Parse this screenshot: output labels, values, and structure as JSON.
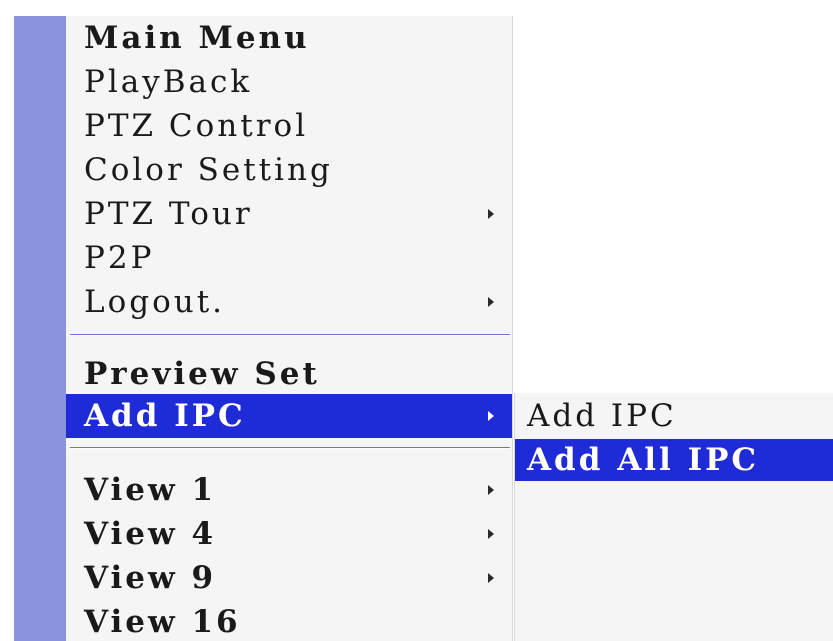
{
  "main_menu": {
    "items": [
      {
        "label": "Main Menu",
        "has_submenu": false
      },
      {
        "label": "PlayBack",
        "has_submenu": false
      },
      {
        "label": "PTZ Control",
        "has_submenu": false
      },
      {
        "label": "Color Setting",
        "has_submenu": false
      },
      {
        "label": "PTZ Tour",
        "has_submenu": true
      },
      {
        "label": "P2P",
        "has_submenu": false
      },
      {
        "label": "Logout.",
        "has_submenu": true
      },
      {
        "label": "Preview Set",
        "has_submenu": false
      },
      {
        "label": "Add IPC",
        "has_submenu": true,
        "selected": true
      },
      {
        "label": "View 1",
        "has_submenu": true
      },
      {
        "label": "View 4",
        "has_submenu": true
      },
      {
        "label": "View 9",
        "has_submenu": true
      },
      {
        "label": "View 16",
        "has_submenu": false
      }
    ]
  },
  "submenu": {
    "items": [
      {
        "label": "Add IPC"
      },
      {
        "label": "Add All IPC",
        "selected": true
      }
    ]
  },
  "colors": {
    "highlight": "#1f2bd6",
    "menu_background": "#f5f5f5",
    "side_stripe": "#8b93dd"
  }
}
